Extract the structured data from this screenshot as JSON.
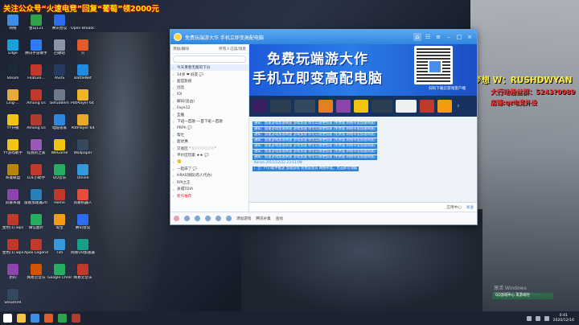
{
  "promo_banner": "关注公众号“火速电竞”回复“葡萄”领2000元",
  "desktop_icons": [
    {
      "label": "网络",
      "color": "#3d8ee6"
    },
    {
      "label": "金山121",
      "color": "#2fa24a"
    },
    {
      "label": "腾讯会议",
      "color": "#2b6cf0"
    },
    {
      "label": "Open Broadcast...",
      "color": "#222833"
    },
    {
      "label": "Edge",
      "color": "#1aa0d8"
    },
    {
      "label": "腾讯手游助手",
      "color": "#2e7cf6"
    },
    {
      "label": "回收站",
      "color": "#8a96a8"
    },
    {
      "label": "火",
      "color": "#e35b2a"
    },
    {
      "label": "Steam",
      "color": "#1b2838"
    },
    {
      "label": "Feature...",
      "color": "#c0392b"
    },
    {
      "label": "ASUS",
      "color": "#243a5e"
    },
    {
      "label": "BattleNet",
      "color": "#1f8ae0"
    },
    {
      "label": "Ling-...",
      "color": "#e7a93a"
    },
    {
      "label": "Among Us",
      "color": "#c0392b"
    },
    {
      "label": "befuddem",
      "color": "#6c7a89"
    },
    {
      "label": "PotPlayer 64 bit",
      "color": "#f0b429"
    },
    {
      "label": "YY开播",
      "color": "#f2c318"
    },
    {
      "label": "Among Us",
      "color": "#b03a2e"
    },
    {
      "label": "电脑管家",
      "color": "#2f86de"
    },
    {
      "label": "PotPlayer 64",
      "color": "#e8a92a"
    },
    {
      "label": "YY游戏助手",
      "color": "#f2c318"
    },
    {
      "label": "炫我的之家",
      "color": "#9b59b6"
    },
    {
      "label": "WeGame",
      "color": "#f1c40f"
    },
    {
      "label": "Wallpaper",
      "color": "#34495e"
    },
    {
      "label": "英雄联盟",
      "color": "#b8860b"
    },
    {
      "label": "LOL小助手",
      "color": "#c0392b"
    },
    {
      "label": "QQ音乐",
      "color": "#27ae60"
    },
    {
      "label": "Online",
      "color": "#3498db"
    },
    {
      "label": "风暴英雄",
      "color": "#8e44ad"
    },
    {
      "label": "雷霆加速器2077",
      "color": "#2980b9"
    },
    {
      "label": "Home",
      "color": "#c0392b"
    },
    {
      "label": "风暴机器人",
      "color": "#e74c3c"
    },
    {
      "label": "金色(1).wps",
      "color": "#c0392b"
    },
    {
      "label": "微信图片",
      "color": "#27ae60"
    },
    {
      "label": "淘宝",
      "color": "#f39c12"
    },
    {
      "label": "腾讯会议",
      "color": "#2b6cf0"
    },
    {
      "label": "金色(1).wps",
      "color": "#c0392b"
    },
    {
      "label": "Apex Legends",
      "color": "#c0392b"
    },
    {
      "label": "Tim",
      "color": "#3498db"
    },
    {
      "label": "网易UU加速器",
      "color": "#16a085"
    },
    {
      "label": "新的",
      "color": "#8e44ad"
    },
    {
      "label": "网易云音乐",
      "color": "#d35400"
    },
    {
      "label": "Google Chrome",
      "color": "#27ae60"
    },
    {
      "label": "网易云音乐",
      "color": "#c0392b"
    },
    {
      "label": "SteamVR",
      "color": "#34495e"
    }
  ],
  "qq": {
    "title": "免费玩端游大作 手机立即变高配电脑",
    "left_header": "添加/删除",
    "left_header_right": "所有人已读/消息",
    "contacts": [
      {
        "label": "今天青春无敌的下分",
        "hl": true
      },
      {
        "label": "14岁 ❤ 好友 💬"
      },
      {
        "label": "超官影视"
      },
      {
        "label": "创造"
      },
      {
        "label": "IOI"
      },
      {
        "label": "解码(追凶)"
      },
      {
        "label": "Faye12"
      },
      {
        "label": "互推"
      },
      {
        "label": "下班一首歌-一首下班一首歌"
      },
      {
        "label": "PRPh 💬"
      },
      {
        "label": "帮忙"
      },
      {
        "label": "超优惠"
      },
      {
        "label": "交易区 “♡♡♡♡♡♡♡”"
      },
      {
        "label": "平价区玩家 ★★ 💬"
      },
      {
        "label": "🙂"
      },
      {
        "label": "一起床了 💬"
      },
      {
        "label": "HRAS领取(有人代办)"
      },
      {
        "label": "RPI之王"
      },
      {
        "label": "县城TDIA"
      },
      {
        "label": "新作推荐",
        "red": true
      }
    ],
    "banner_line1": "免费玩端游大作",
    "banner_line2": "手机立即变高配电脑",
    "banner_qr_caption": "扫码下载云游戏客户端",
    "game_icons": [
      {
        "color": "#3b1f5e",
        "wide": false
      },
      {
        "color": "#2c3e50",
        "wide": true
      },
      {
        "color": "#34495e",
        "wide": true
      },
      {
        "color": "#e67e22",
        "wide": false
      },
      {
        "color": "#8e44ad",
        "wide": false
      },
      {
        "color": "#f1c40f",
        "wide": false
      },
      {
        "color": "#2c3e50",
        "wide": true
      },
      {
        "color": "#ecf0f1",
        "wide": true
      },
      {
        "color": "#c0392b",
        "wide": false
      },
      {
        "color": "#f39c12",
        "wide": false
      }
    ],
    "chat_msgs": [
      "通知：加速游戏加速网速 游戏加速 你可以随便加速 [免费版 网络带宽加速网速]",
      "通知：加速游戏加速网速 游戏加速 你可以随便加速 [免费版 网络带宽加速网速]",
      "通知：加速游戏加速网速 游戏加速 你可以随便加速 [免费版 网络带宽加速网速]",
      "通知：加速游戏加速网速 游戏加速 你可以随便加速 [免费版 网络带宽加速网速]",
      "通知：加速游戏加速网速 游戏加速 你可以随便加速 [免费版 网络带宽加速网速]",
      "通知：加速游戏加速网速 游戏加速 你可以随便加速 [免费版 网络带宽加速网速]",
      "通知：加速游戏加速网速 游戏加速 你可以随便加速 [免费版 网络带宽加速网速]"
    ],
    "timestamp": "Kensa 2015/12/22 23:11:09",
    "ad_msg": "广告: YY小助手推送 加速游戏 免费送会员 网络带宽，点击即可领取",
    "send_label": "发送",
    "apps_label": "应用中心",
    "bottom_items": [
      "添加游戏",
      "腾讯补集",
      "查找"
    ]
  },
  "side_text": {
    "line1": "梦想 W：RUSHDWYAN",
    "line2": "大行动粉丝群：5243?0089",
    "line3": "店铺:qz电竞外设"
  },
  "activate": {
    "title": "激活 Windows",
    "sub": "转到\"设置\"以激活 Windows。"
  },
  "qq_float_text": "QQ游戏中心 来游戏吧",
  "taskbar": {
    "icons": [
      "#ffffff",
      "#f5c542",
      "#3d8ee6",
      "#e35b2a",
      "#2fa24a",
      "#b23a2e"
    ],
    "time": "0:41",
    "date": "2020/12/16"
  }
}
